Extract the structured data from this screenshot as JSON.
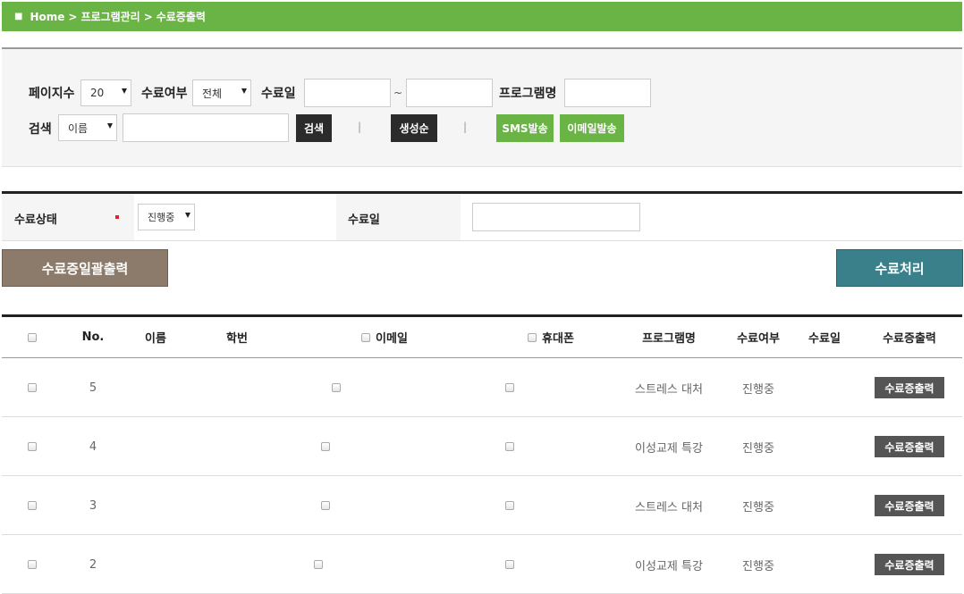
{
  "breadcrumb": {
    "home": "Home",
    "section": "프로그램관리",
    "current": "수료증출력"
  },
  "filters": {
    "page_size_label": "페이지수",
    "page_size_value": "20",
    "completion_label": "수료여부",
    "completion_value": "전체",
    "completion_date_label": "수료일",
    "date_from": "",
    "date_separator": "~",
    "date_to": "",
    "program_name_label": "프로그램명",
    "program_name_value": "",
    "search_label": "검색",
    "search_field_value": "이름",
    "search_value": "",
    "search_button": "검색",
    "pipe": "|",
    "generate_button": "생성순",
    "sms_button": "SMS발송",
    "email_button": "이메일발송"
  },
  "status_form": {
    "status_label": "수료상태",
    "status_value": "진행중",
    "date_label": "수료일",
    "date_value": ""
  },
  "actions": {
    "bulk_print": "수료증일괄출력",
    "process": "수료처리"
  },
  "table": {
    "headers": [
      "No.",
      "이름",
      "학번",
      "이메일",
      "휴대폰",
      "프로그램명",
      "수료여부",
      "수료일",
      "수료증출력"
    ],
    "rows": [
      {
        "no": "5",
        "name": "",
        "student_id": "",
        "program": "스트레스 대처",
        "status": "진행중",
        "date": "",
        "action": "수료증출력"
      },
      {
        "no": "4",
        "name": "",
        "student_id": "",
        "program": "이성교제 특강",
        "status": "진행중",
        "date": "",
        "action": "수료증출력"
      },
      {
        "no": "3",
        "name": "",
        "student_id": "",
        "program": "스트레스 대처",
        "status": "진행중",
        "date": "",
        "action": "수료증출력"
      },
      {
        "no": "2",
        "name": "",
        "student_id": "",
        "program": "이성교제 특강",
        "status": "진행중",
        "date": "",
        "action": "수료증출력"
      }
    ]
  },
  "colors": {
    "green": "#6ab445",
    "dark": "#2b2b2b",
    "brown": "#8c7b6b",
    "teal": "#3a808b",
    "required": "#d9232d"
  }
}
